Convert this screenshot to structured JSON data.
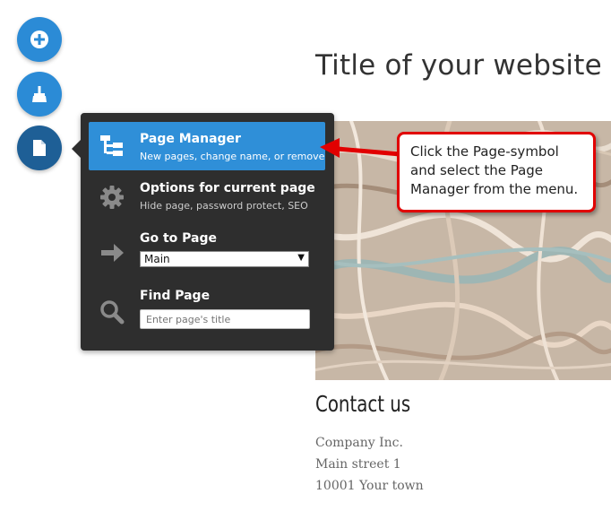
{
  "site": {
    "title": "Title of your website",
    "contact_title": "Contact us",
    "address": [
      "Company Inc.",
      "Main street 1",
      "10001 Your town"
    ]
  },
  "toolbar": {
    "buttons": [
      {
        "icon": "plus-circle-icon"
      },
      {
        "icon": "brush-icon"
      },
      {
        "icon": "page-icon"
      }
    ]
  },
  "menu": {
    "items": [
      {
        "title": "Page Manager",
        "subtitle": "New pages, change name, or remove",
        "icon": "sitemap-icon"
      },
      {
        "title": "Options for current page",
        "subtitle": "Hide page, password protect, SEO",
        "icon": "gear-icon"
      },
      {
        "title": "Go to Page",
        "icon": "arrow-right-icon"
      },
      {
        "title": "Find Page",
        "icon": "search-icon"
      }
    ],
    "go_to_page_value": "Main",
    "find_placeholder": "Enter page's title"
  },
  "callout": {
    "text": "Click the Page-symbol and select the Page Manager from the menu."
  },
  "colors": {
    "accent": "#2b8bd6",
    "accent_active": "#1e5f96",
    "menu_bg": "#2e2e2e",
    "callout_border": "#e10000"
  }
}
